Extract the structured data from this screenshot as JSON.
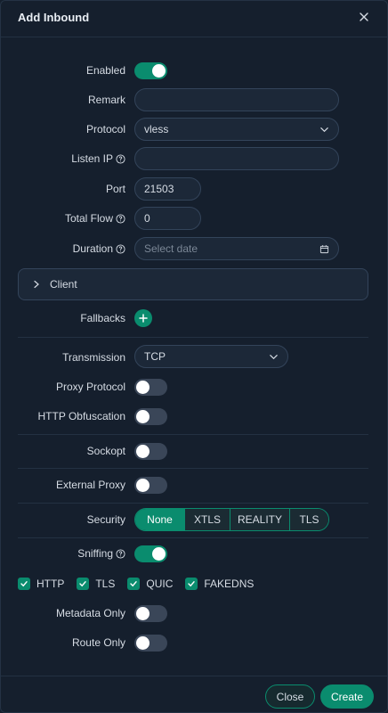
{
  "modal": {
    "title": "Add Inbound"
  },
  "form": {
    "enabled": {
      "label": "Enabled",
      "on": true
    },
    "remark": {
      "label": "Remark",
      "value": ""
    },
    "protocol": {
      "label": "Protocol",
      "value": "vless"
    },
    "listen_ip": {
      "label": "Listen IP",
      "value": ""
    },
    "port": {
      "label": "Port",
      "value": "21503"
    },
    "total_flow": {
      "label": "Total Flow",
      "value": "0"
    },
    "duration": {
      "label": "Duration",
      "placeholder": "Select date"
    },
    "client": {
      "label": "Client"
    },
    "fallbacks": {
      "label": "Fallbacks"
    },
    "transmission": {
      "label": "Transmission",
      "value": "TCP"
    },
    "proxy_protocol": {
      "label": "Proxy Protocol",
      "on": false
    },
    "http_obfuscation": {
      "label": "HTTP Obfuscation",
      "on": false
    },
    "sockopt": {
      "label": "Sockopt",
      "on": false
    },
    "external_proxy": {
      "label": "External Proxy",
      "on": false
    },
    "security": {
      "label": "Security",
      "options": [
        "None",
        "XTLS",
        "REALITY",
        "TLS"
      ],
      "selected": "None"
    },
    "sniffing": {
      "label": "Sniffing",
      "on": true
    },
    "sniff_options": [
      {
        "label": "HTTP",
        "checked": true
      },
      {
        "label": "TLS",
        "checked": true
      },
      {
        "label": "QUIC",
        "checked": true
      },
      {
        "label": "FAKEDNS",
        "checked": true
      }
    ],
    "metadata_only": {
      "label": "Metadata Only",
      "on": false
    },
    "route_only": {
      "label": "Route Only",
      "on": false
    }
  },
  "footer": {
    "close_label": "Close",
    "create_label": "Create"
  },
  "colors": {
    "accent": "#0a8c6e",
    "background": "#151f2d",
    "field_bg": "#1c2838"
  }
}
